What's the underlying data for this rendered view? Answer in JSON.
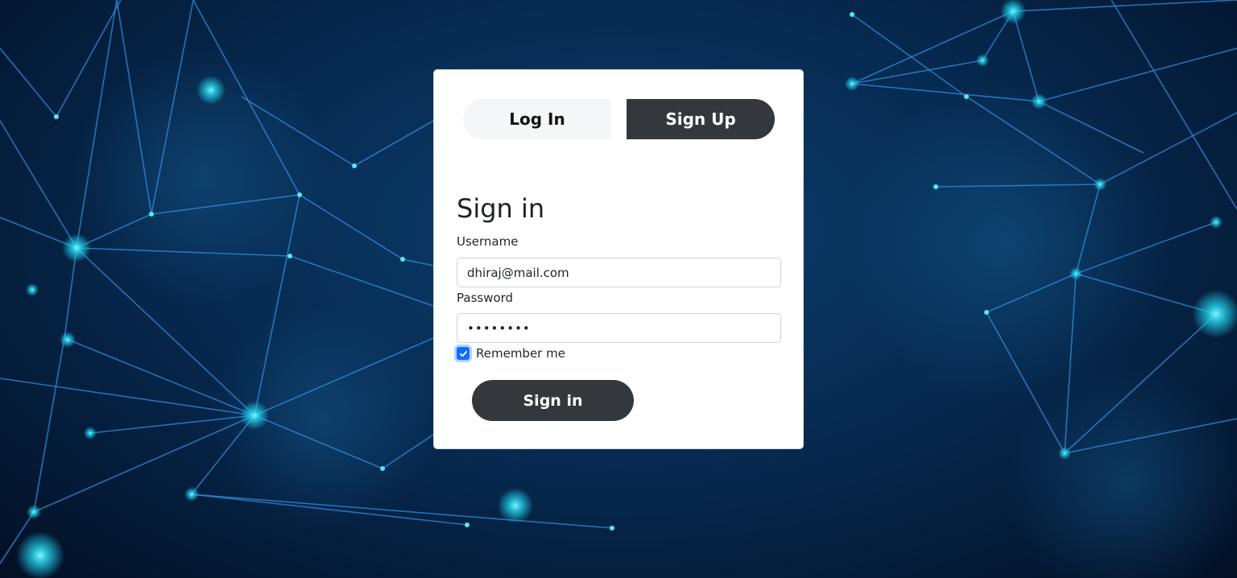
{
  "tabs": {
    "login_label": "Log In",
    "signup_label": "Sign Up"
  },
  "form": {
    "title": "Sign in",
    "username_label": "Username",
    "username_value": "dhiraj@mail.com",
    "password_label": "Password",
    "password_value": "••••••••",
    "remember_label": "Remember me",
    "remember_checked": true,
    "submit_label": "Sign in"
  },
  "colors": {
    "accent": "#0d6efd",
    "dark_button": "#34383d",
    "background_deep": "#041a36",
    "network_lines": "#2f8ee0",
    "network_nodes": "#35e1f0"
  }
}
